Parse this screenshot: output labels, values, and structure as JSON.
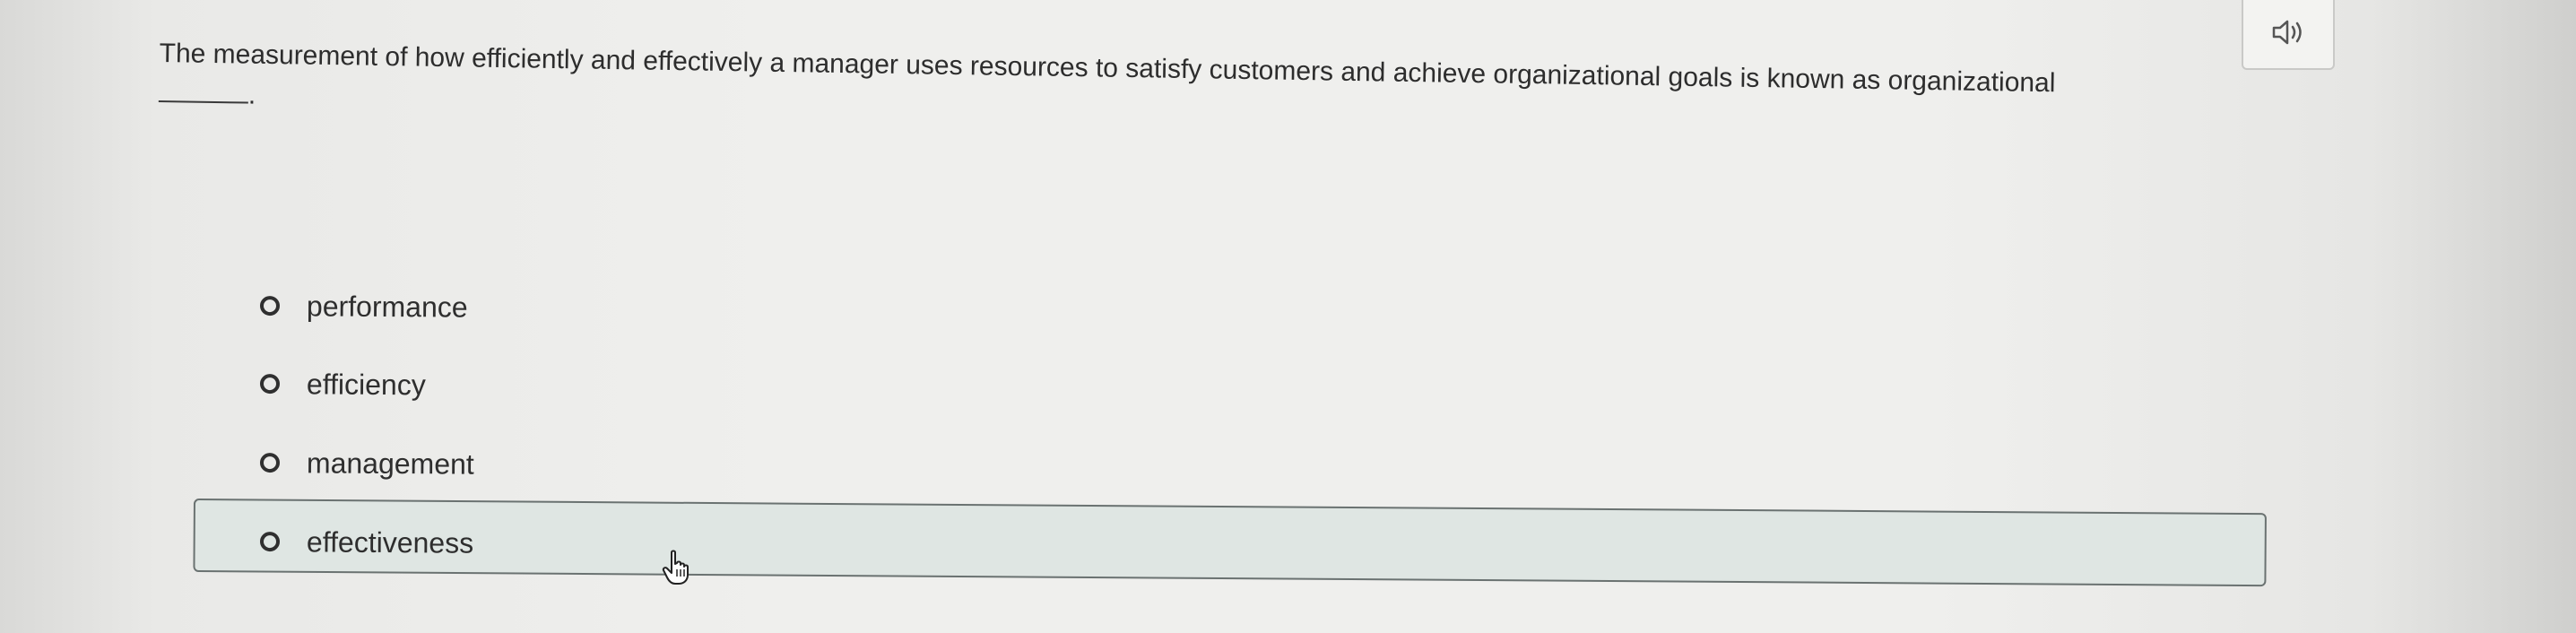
{
  "question": {
    "text": "The measurement of how efficiently and effectively a manager uses resources to satisfy customers and achieve organizational goals is known as organizational",
    "suffix": "."
  },
  "audio_button": {
    "icon": "speaker-icon"
  },
  "options": [
    {
      "label": "performance",
      "selected": false
    },
    {
      "label": "efficiency",
      "selected": false
    },
    {
      "label": "management",
      "selected": false
    },
    {
      "label": "effectiveness",
      "selected": false,
      "hovered": true
    }
  ],
  "colors": {
    "background": "#efefed",
    "text": "#2d2d2d",
    "hover_fill": "#dfe6e3",
    "hover_border": "#6a7271"
  }
}
